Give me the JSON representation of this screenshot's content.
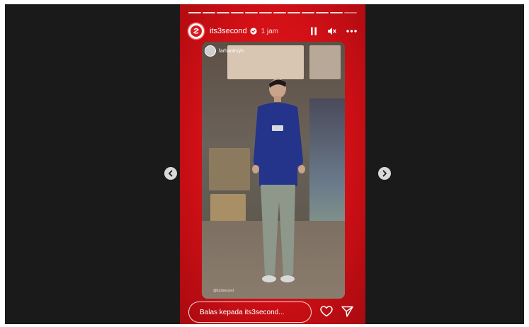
{
  "story": {
    "username": "its3second",
    "time": "1 jam",
    "progress_segments": 12,
    "current_segment": 12
  },
  "photo": {
    "tagged_user": "farhantrsyh",
    "watermark": "@its3second"
  },
  "reply": {
    "placeholder": "Balas kepada its3second..."
  },
  "icons": {
    "pause": "pause-icon",
    "mute": "muted-speaker-icon",
    "more": "more-options-icon",
    "like": "heart-icon",
    "send": "send-icon",
    "prev": "chevron-left-icon",
    "next": "chevron-right-icon",
    "verified": "verified-badge-icon"
  },
  "colors": {
    "story_background": "#d11016",
    "viewer_background": "#1a1a1a"
  }
}
